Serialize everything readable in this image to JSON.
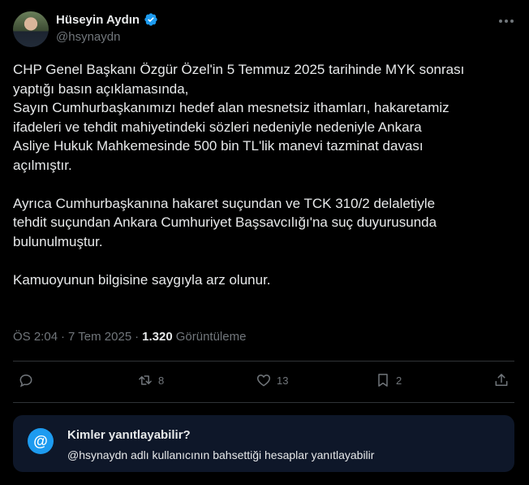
{
  "author": {
    "name": "Hüseyin Aydın",
    "handle": "@hsynaydn",
    "avatar_icon": "user-avatar",
    "verified_icon": "verified-badge-icon"
  },
  "tweet": {
    "text": "CHP Genel Başkanı Özgür Özel'in 5 Temmuz 2025 tarihinde MYK sonrası\nyaptığı basın açıklamasında,\nSayın Cumhurbaşkanımızı hedef alan mesnetsiz ithamları, hakaretamiz\nifadeleri ve tehdit mahiyetindeki sözleri nedeniyle nedeniyle Ankara\nAsliye Hukuk Mahkemesinde 500 bin TL'lik manevi tazminat davası\naçılmıştır.\n\nAyrıca Cumhurbaşkanına hakaret suçundan ve TCK 310/2 delaletiyle\ntehdit suçundan Ankara Cumhuriyet Başsavcılığı'na suç duyurusunda\nbulunulmuştur.\n\nKamuoyunun bilgisine saygıyla arz olunur.",
    "time": "ÖS 2:04",
    "date": "7 Tem 2025",
    "separator": "·",
    "views_count": "1.320",
    "views_label": "Görüntüleme"
  },
  "actions": {
    "reply_count": "",
    "retweet_count": "8",
    "like_count": "13",
    "bookmark_count": "2"
  },
  "reply_restriction": {
    "title": "Kimler yanıtlayabilir?",
    "description": "@hsynaydn adlı kullanıcının bahsettiği hesaplar yanıtlayabilir",
    "icon": "@"
  },
  "colors": {
    "background": "#000000",
    "text": "#e7e9ea",
    "muted": "#71767b",
    "accent": "#1d9bf0",
    "divider": "#2f3336",
    "info_box": "#0e1729"
  }
}
